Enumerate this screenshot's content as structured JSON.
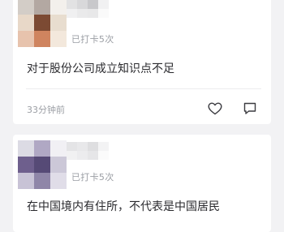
{
  "posts": [
    {
      "checkin": "已打卡5次",
      "content": "对于股份公司成立知识点不足",
      "time": "33分钟前",
      "avatar_colors": [
        "#d3cdc7",
        "#b3a8a2",
        "#f3f0ec",
        "#e8d8c8",
        "#7c4a33",
        "#e8ddcf",
        "#e7c3ad",
        "#cf845f",
        "#f3e8dc"
      ],
      "nickname_colors": [
        "#e2e2e3",
        "#d8d8da",
        "#c8c8cb",
        "#f1f1f2",
        "#f0f0f1",
        "#eaeaeb",
        "#e8e8e9",
        "#fafafa"
      ]
    },
    {
      "checkin": "已打卡5次",
      "content": "在中国境内有住所，不代表是中国居民",
      "avatar_colors": [
        "#dcdbe4",
        "#b0a8c4",
        "#f1f0f4",
        "#6e5f8d",
        "#564a76",
        "#ccc8d8",
        "#c8c3d6",
        "#8f86a8",
        "#e0dde8"
      ],
      "nickname_colors": [
        "#e4e4e6",
        "#e8e8ea",
        "#dedee0",
        "#f3f3f4",
        "#f1f1f2",
        "#ececee",
        "#e6e6e8",
        "#fbfbfb"
      ]
    }
  ],
  "icons": {
    "like": "heart-outline-icon",
    "comment": "comment-bubble-icon"
  }
}
